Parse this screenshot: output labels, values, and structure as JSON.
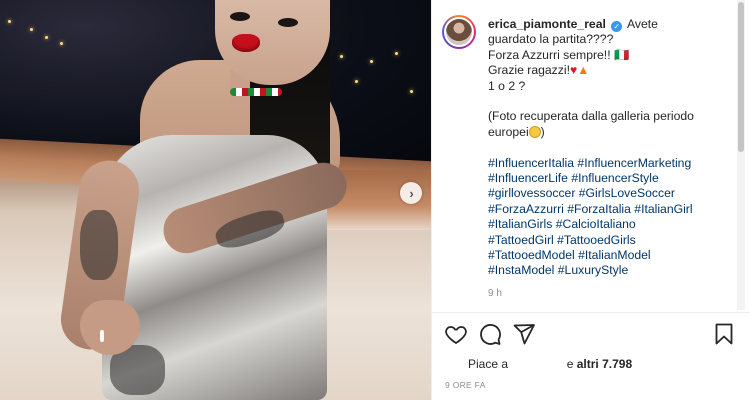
{
  "post": {
    "username": "erica_piamonte_real",
    "verified_mark": "✓",
    "caption_lines": [
      "Avete",
      "guardato la partita????",
      "Forza Azzurri sempre!! 🇮🇹",
      "Grazie ragazzi!",
      "1 o 2 ?"
    ],
    "caption_note_1": "(Foto recuperata dalla galleria periodo",
    "caption_note_2": "europei",
    "caption_note_close": ")",
    "hashtag_lines": [
      "#InfluencerItalia #InfluencerMarketing",
      "#InfluencerLife #InfluencerStyle",
      "#girllovessoccer #GirlsLoveSoccer",
      "#ForzaAzzurri #ForzaItalia #ItalianGirl",
      "#ItalianGirls #CalcioItaliano",
      "#TattoedGirl #TattooedGirls",
      "#TattooedModel #ItalianModel",
      "#InstaModel #LuxuryStyle"
    ],
    "relative_time": "9 h",
    "likes_prefix": "Piace a",
    "likes_middle": "e",
    "likes_count_text": "altri 7.798",
    "post_time": "9 ORE FA"
  },
  "icons": {
    "heart": "heart-outline-icon",
    "comment": "comment-bubble-icon",
    "share": "paper-plane-icon",
    "save": "bookmark-icon",
    "next": "chevron-right-icon",
    "heart_emoji": "red-heart-emoji",
    "fire_emoji": "fire-emoji",
    "smile_emoji": "grinning-face-emoji"
  },
  "colors": {
    "text": "#262626",
    "muted": "#8e8e8e",
    "hashtag": "#00376b",
    "verified": "#3897f0"
  },
  "media": {
    "next_arrow": "›"
  }
}
